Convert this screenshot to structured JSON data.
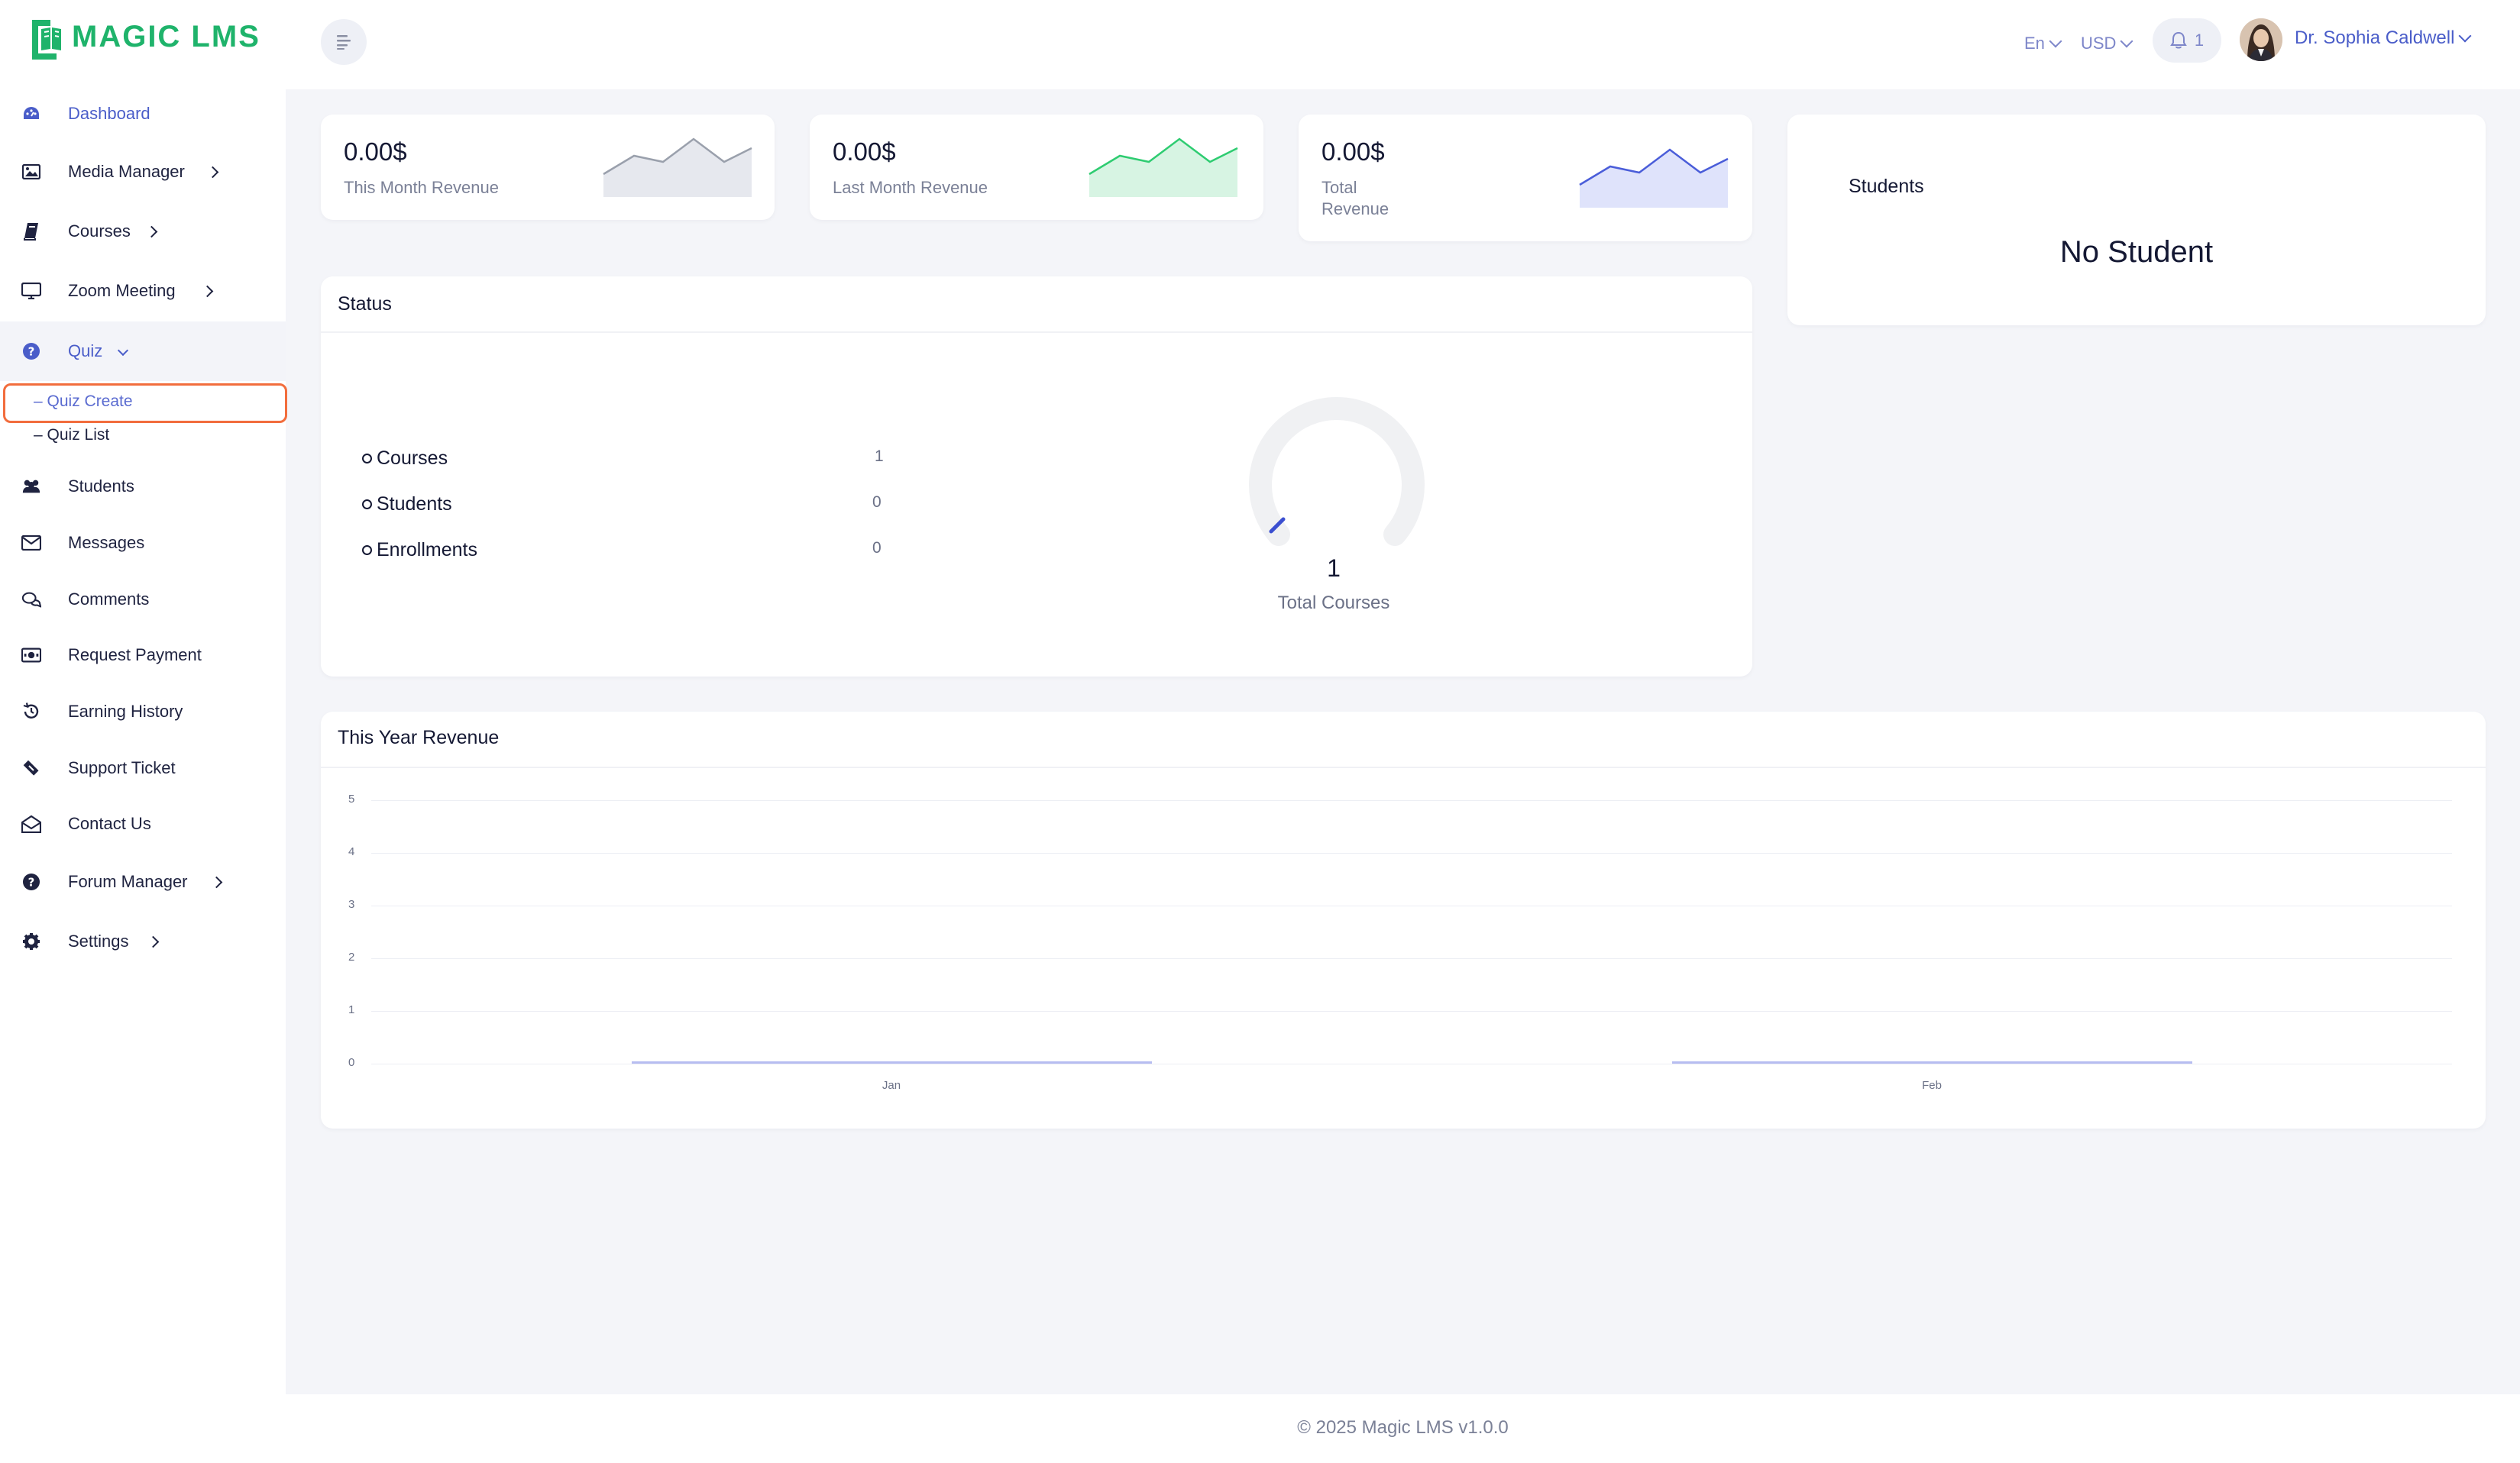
{
  "app": {
    "logo_text": "MAGIC LMS"
  },
  "header": {
    "language": "En",
    "currency": "USD",
    "notification_count": "1",
    "user_name": "Dr. Sophia Caldwell"
  },
  "sidebar": {
    "items": [
      {
        "label": "Dashboard",
        "icon": "dashboard-icon"
      },
      {
        "label": "Media Manager",
        "icon": "image-icon"
      },
      {
        "label": "Courses",
        "icon": "book-icon"
      },
      {
        "label": "Zoom Meeting",
        "icon": "monitor-icon"
      },
      {
        "label": "Quiz",
        "icon": "question-circle-icon"
      },
      {
        "label": "Students",
        "icon": "users-icon"
      },
      {
        "label": "Messages",
        "icon": "envelope-icon"
      },
      {
        "label": "Comments",
        "icon": "comments-icon"
      },
      {
        "label": "Request Payment",
        "icon": "money-bill-icon"
      },
      {
        "label": "Earning History",
        "icon": "history-icon"
      },
      {
        "label": "Support Ticket",
        "icon": "ticket-icon"
      },
      {
        "label": "Contact Us",
        "icon": "envelope-open-icon"
      },
      {
        "label": "Forum Manager",
        "icon": "question-circle-icon"
      },
      {
        "label": "Settings",
        "icon": "gear-icon"
      }
    ],
    "quiz_sub": [
      {
        "label": "– Quiz Create"
      },
      {
        "label": "– Quiz List"
      }
    ]
  },
  "revenue_cards": [
    {
      "value": "0.00$",
      "label": "This Month Revenue",
      "color": "#9aa0ac"
    },
    {
      "value": "0.00$",
      "label": "Last Month Revenue",
      "color": "#2ecc71"
    },
    {
      "value": "0.00$",
      "label": "Total Revenue",
      "color": "#4a5dd9"
    }
  ],
  "students_card": {
    "title": "Students",
    "empty_text": "No Student"
  },
  "status_card": {
    "title": "Status",
    "rows": [
      {
        "label": "Courses",
        "value": "1"
      },
      {
        "label": "Students",
        "value": "0"
      },
      {
        "label": "Enrollments",
        "value": "0"
      }
    ],
    "gauge_value": "1",
    "gauge_label": "Total Courses"
  },
  "revenue_chart": {
    "title": "This Year Revenue"
  },
  "chart_data": {
    "type": "bar",
    "title": "This Year Revenue",
    "categories": [
      "Jan",
      "Feb"
    ],
    "values": [
      0,
      0
    ],
    "y_ticks": [
      "0",
      "1",
      "2",
      "3",
      "4",
      "5"
    ],
    "ylim": [
      0,
      5
    ],
    "grid": true,
    "color": "#7b86e6"
  },
  "footer": {
    "text": "© 2025 Magic LMS v1.0.0"
  }
}
